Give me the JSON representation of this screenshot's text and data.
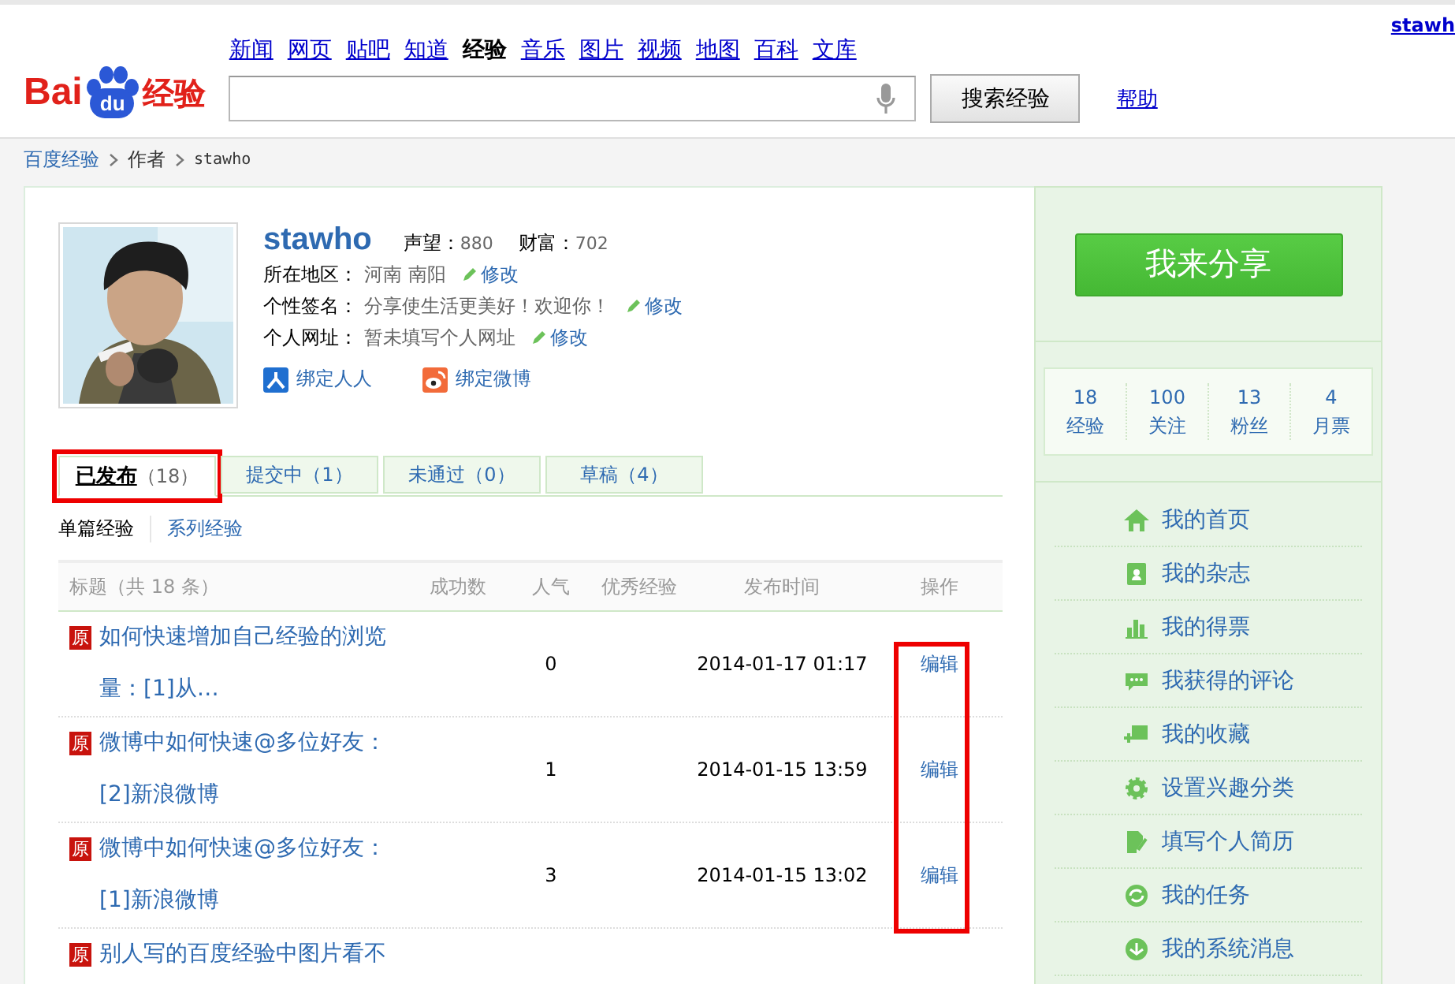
{
  "header": {
    "logo": {
      "left": "Bai",
      "badge": "du",
      "right": "经验"
    },
    "nav": [
      {
        "label": "新闻",
        "selected": false
      },
      {
        "label": "网页",
        "selected": false
      },
      {
        "label": "贴吧",
        "selected": false
      },
      {
        "label": "知道",
        "selected": false
      },
      {
        "label": "经验",
        "selected": true
      },
      {
        "label": "音乐",
        "selected": false
      },
      {
        "label": "图片",
        "selected": false
      },
      {
        "label": "视频",
        "selected": false
      },
      {
        "label": "地图",
        "selected": false
      },
      {
        "label": "百科",
        "selected": false
      },
      {
        "label": "文库",
        "selected": false
      }
    ],
    "search_button": "搜索经验",
    "help": "帮助",
    "user": "stawh"
  },
  "breadcrumb": [
    "百度经验",
    "作者",
    "stawho"
  ],
  "profile": {
    "name": "stawho",
    "stats": [
      {
        "label": "声望：",
        "value": "880"
      },
      {
        "label": "财富：",
        "value": "702"
      }
    ],
    "fields": [
      {
        "label": "所在地区：",
        "value": "河南 南阳",
        "edit": "修改"
      },
      {
        "label": "个性签名：",
        "value": "分享使生活更美好！欢迎你！",
        "edit": "修改"
      },
      {
        "label": "个人网址：",
        "value": "暂未填写个人网址",
        "edit": "修改"
      }
    ],
    "bindings": [
      {
        "kind": "renren",
        "label": "绑定人人"
      },
      {
        "kind": "weibo",
        "label": "绑定微博"
      }
    ]
  },
  "tabs": [
    {
      "label": "已发布",
      "count": "（18）",
      "selected": true,
      "highlighted": true
    },
    {
      "label": "提交中",
      "count": "（1）",
      "selected": false,
      "highlighted": false
    },
    {
      "label": "未通过",
      "count": "（0）",
      "selected": false,
      "highlighted": false
    },
    {
      "label": "草稿",
      "count": "（4）",
      "selected": false,
      "highlighted": false
    }
  ],
  "subtabs": [
    {
      "label": "单篇经验",
      "selected": true
    },
    {
      "label": "系列经验",
      "selected": false
    }
  ],
  "table": {
    "columns": [
      "标题（共 18 条）",
      "成功数",
      "人气",
      "优秀经验",
      "发布时间",
      "操作"
    ],
    "action_column_highlighted": true,
    "rows": [
      {
        "badge": "原",
        "title": "如何快速增加自己经验的浏览量：[1]从…",
        "popularity": "0",
        "time": "2014-01-17 01:17",
        "action": "编辑"
      },
      {
        "badge": "原",
        "title": "微博中如何快速@多位好友：[2]新浪微博",
        "popularity": "1",
        "time": "2014-01-15 13:59",
        "action": "编辑"
      },
      {
        "badge": "原",
        "title": "微博中如何快速@多位好友：[1]新浪微博",
        "popularity": "3",
        "time": "2014-01-15 13:02",
        "action": "编辑"
      },
      {
        "badge": "原",
        "title": "别人写的百度经验中图片看不"
      }
    ]
  },
  "sidebar": {
    "share_button": "我来分享",
    "counts": [
      {
        "value": "18",
        "label": "经验"
      },
      {
        "value": "100",
        "label": "关注"
      },
      {
        "value": "13",
        "label": "粉丝"
      },
      {
        "value": "4",
        "label": "月票"
      }
    ],
    "menu": [
      {
        "kind": "home",
        "label": "我的首页"
      },
      {
        "kind": "magazine",
        "label": "我的杂志"
      },
      {
        "kind": "votes",
        "label": "我的得票"
      },
      {
        "kind": "comments",
        "label": "我获得的评论"
      },
      {
        "kind": "favorites",
        "label": "我的收藏"
      },
      {
        "kind": "settings",
        "label": "设置兴趣分类"
      },
      {
        "kind": "resume",
        "label": "填写个人简历"
      },
      {
        "kind": "tasks",
        "label": "我的任务"
      },
      {
        "kind": "messages",
        "label": "我的系统消息"
      }
    ]
  }
}
